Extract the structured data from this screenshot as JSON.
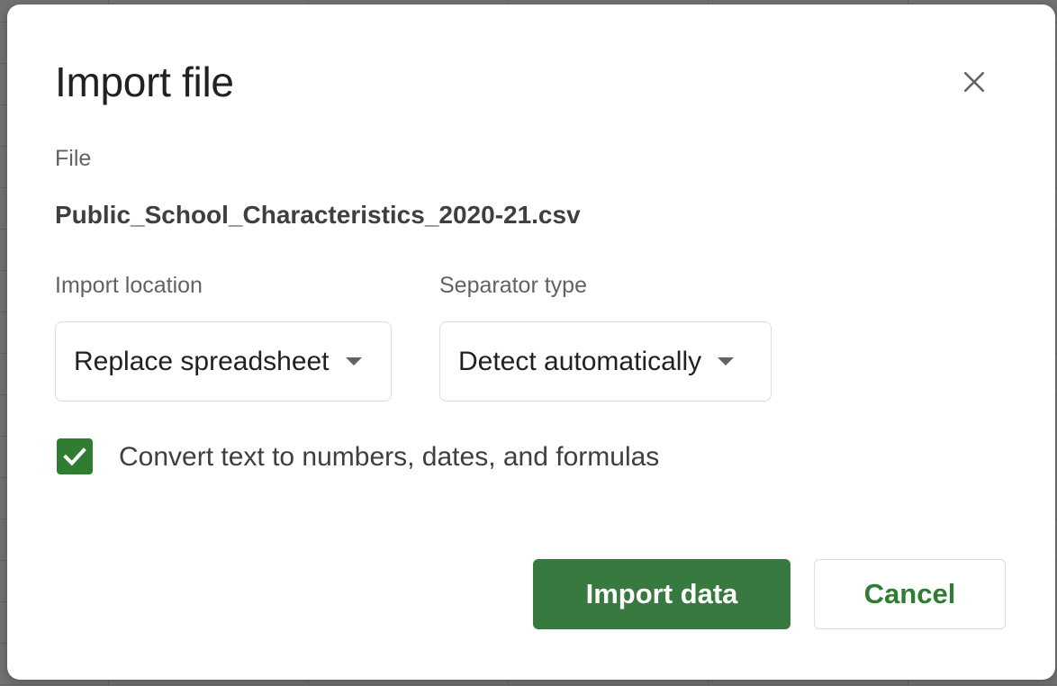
{
  "dialog": {
    "title": "Import file",
    "close_icon": "close-icon",
    "file_label": "File",
    "file_name": "Public_School_Characteristics_2020-21.csv",
    "import_location": {
      "label": "Import location",
      "selected": "Replace spreadsheet"
    },
    "separator_type": {
      "label": "Separator type",
      "selected": "Detect automatically"
    },
    "convert_checkbox": {
      "label": "Convert text to numbers, dates, and formulas",
      "checked": true
    },
    "import_button": "Import data",
    "cancel_button": "Cancel"
  },
  "colors": {
    "accent_green": "#37793f",
    "text_dark": "#202124",
    "text_muted": "#5f6368",
    "border": "#dadce0"
  }
}
